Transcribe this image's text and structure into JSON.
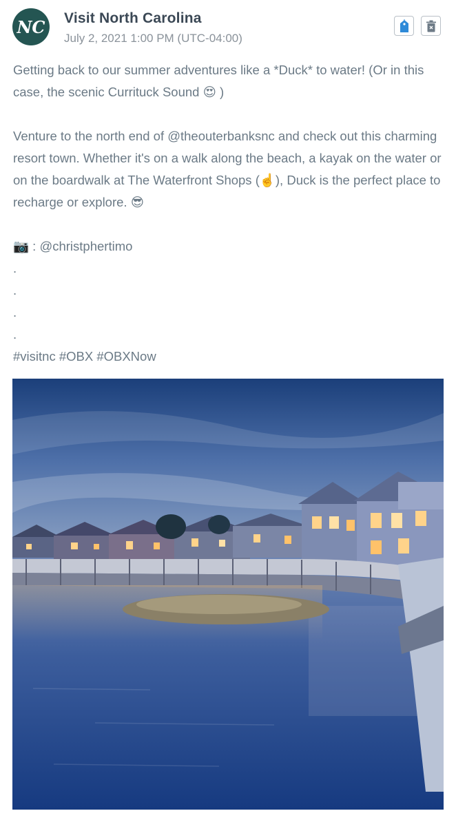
{
  "post": {
    "author": "Visit North Carolina",
    "timestamp": "July 2, 2021 1:00 PM (UTC-04:00)",
    "avatar_initials": "NC",
    "avatar_color": "#245552",
    "actions": [
      {
        "name": "tag-button",
        "icon": "tag-icon",
        "color": "#2e8ad8"
      },
      {
        "name": "delete-button",
        "icon": "trash-icon",
        "color": "#6e7b87"
      }
    ],
    "caption": "Getting back to our summer adventures like a *Duck* to water! (Or in this case, the scenic Currituck Sound 😍 )\n\nVenture to the north end of @theouterbanksnc and check out this charming resort town. Whether it's on a walk along the beach, a kayak on the water or on the boardwalk at The Waterfront Shops (☝️), Duck is the perfect place to recharge or explore. 😎\n\n📷 : @christphertimo\n.\n.\n.\n.\n#visitnc #OBX #OBXNow",
    "image_subject": "boardwalk-waterfront-photo"
  }
}
